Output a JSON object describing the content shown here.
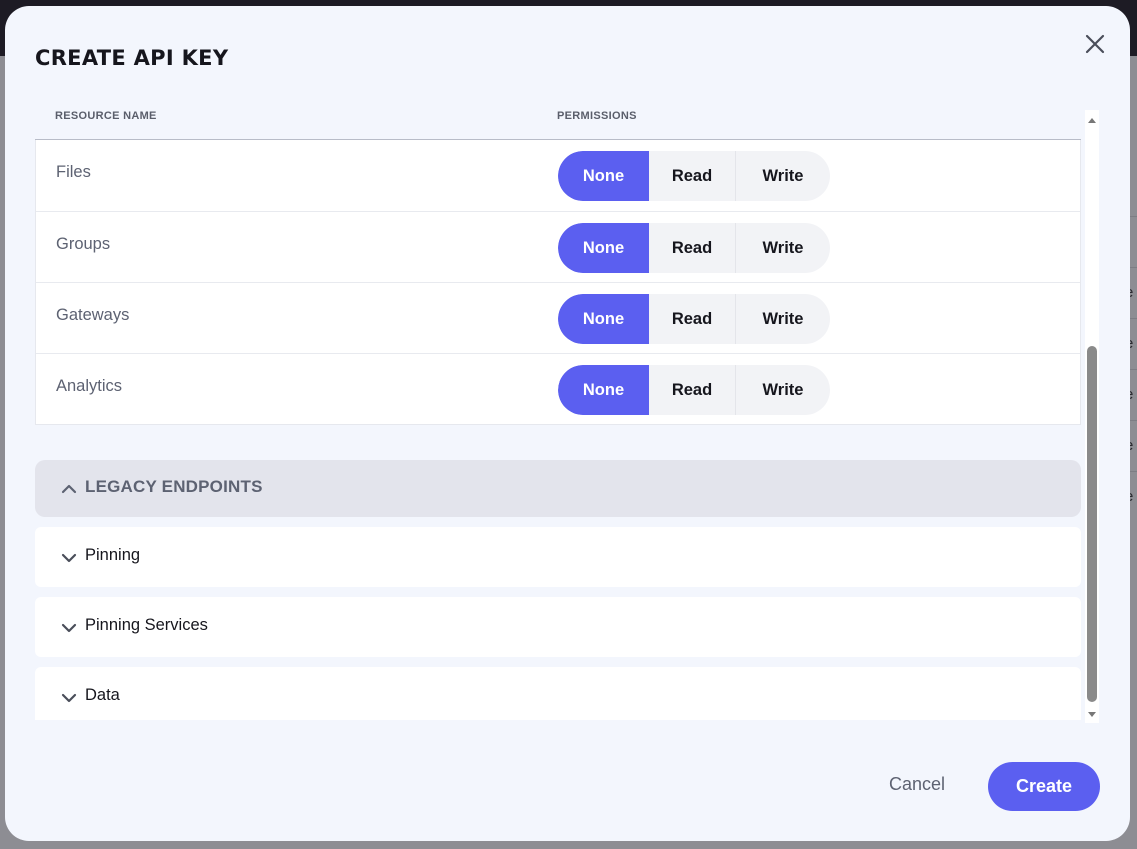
{
  "background": {
    "table_cells": [
      "s",
      "re",
      "re",
      "re",
      "re",
      "re"
    ]
  },
  "modal": {
    "title": "CREATE API KEY",
    "close_icon": "close-icon"
  },
  "table": {
    "headers": {
      "resource_name": "RESOURCE NAME",
      "permissions": "PERMISSIONS"
    },
    "rows": [
      {
        "label": "Files",
        "selected": "None"
      },
      {
        "label": "Groups",
        "selected": "None"
      },
      {
        "label": "Gateways",
        "selected": "None"
      },
      {
        "label": "Analytics",
        "selected": "None"
      }
    ],
    "options": {
      "none": "None",
      "read": "Read",
      "write": "Write"
    }
  },
  "legacy": {
    "title": "LEGACY ENDPOINTS",
    "expanded": true,
    "items": [
      {
        "label": "Pinning"
      },
      {
        "label": "Pinning Services"
      },
      {
        "label": "Data"
      }
    ]
  },
  "footer": {
    "cancel_label": "Cancel",
    "create_label": "Create"
  },
  "colors": {
    "accent": "#5b5ff0",
    "modal_bg": "#f3f6fd",
    "legacy_bg": "#e3e4ec",
    "text_dark": "#16161d",
    "text_muted": "#5d6272"
  }
}
